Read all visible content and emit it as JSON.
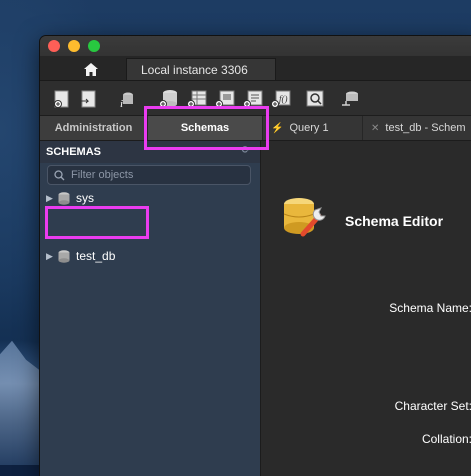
{
  "connection_tabs": {
    "home_icon": "home-icon",
    "instance_label": "Local instance 3306"
  },
  "toolbar": {
    "icons": [
      "new-sql-tab-icon",
      "open-sql-file-icon",
      "info-icon",
      "create-schema-icon",
      "create-table-icon",
      "create-view-icon",
      "create-procedure-icon",
      "create-function-icon",
      "search-table-icon",
      "reconnect-icon"
    ]
  },
  "sidebar_tabs": {
    "administration": "Administration",
    "schemas": "Schemas"
  },
  "editor_tabs": {
    "query": "Query 1",
    "schema_editor": "test_db - Schem"
  },
  "sidebar": {
    "header": "SCHEMAS",
    "filter_placeholder": "Filter objects",
    "schemas": [
      {
        "name": "sys"
      },
      {
        "name": "test_db"
      }
    ]
  },
  "schema_editor": {
    "title": "Schema Editor",
    "schema_name_label": "Schema Name:",
    "character_set_label": "Character Set:",
    "collation_label": "Collation:"
  },
  "colors": {
    "highlight": "#ea3cf0",
    "sidebar_bg": "#2f3d4f"
  }
}
